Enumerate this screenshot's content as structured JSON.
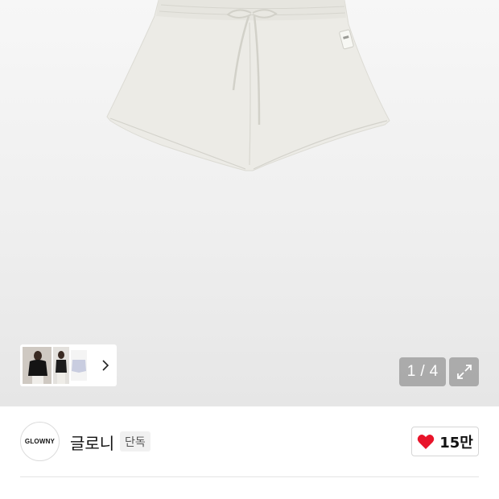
{
  "gallery": {
    "current_page": "1",
    "separator": "/",
    "total_pages": "4"
  },
  "brand": {
    "logo_text": "GLOWNY",
    "name": "글로니",
    "badge": "단독"
  },
  "like": {
    "count": "15만",
    "color": "#e8142a"
  },
  "icons": {
    "expand": "expand-icon",
    "chevron": "chevron-right-icon",
    "heart": "heart-icon"
  }
}
